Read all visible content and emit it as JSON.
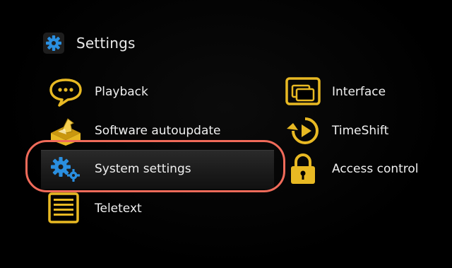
{
  "header": {
    "title": "Settings",
    "icon": "settings-gear-icon"
  },
  "menu": {
    "left": [
      {
        "label": "Playback",
        "icon": "speech-bubble-icon"
      },
      {
        "label": "Software autoupdate",
        "icon": "software-package-icon"
      },
      {
        "label": "System settings",
        "icon": "gears-icon",
        "selected": true
      },
      {
        "label": "Teletext",
        "icon": "teletext-document-icon"
      }
    ],
    "right": [
      {
        "label": "Interface",
        "icon": "interface-windows-icon"
      },
      {
        "label": "TimeShift",
        "icon": "timeshift-play-icon"
      },
      {
        "label": "Access control",
        "icon": "padlock-icon"
      }
    ]
  },
  "colors": {
    "accent_yellow": "#e8b923",
    "icon_blue": "#2a8fe0",
    "highlight_ring": "#f06b5a",
    "background": "#000000"
  }
}
